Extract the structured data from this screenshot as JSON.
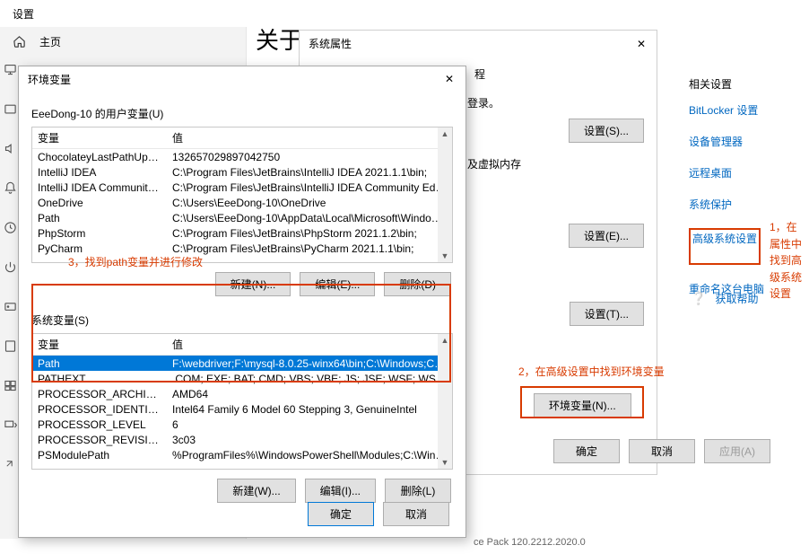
{
  "titlebar": "设置",
  "sidebar": {
    "home": "主页"
  },
  "content": {
    "heading": "关于"
  },
  "related": {
    "title": "相关设置",
    "links": [
      "BitLocker 设置",
      "设备管理器",
      "远程桌面",
      "系统保护",
      "高级系统设置",
      "重命名这台电脑"
    ],
    "help": "获取帮助"
  },
  "ann": {
    "a1": "1，在属性中找到高级系统设置",
    "a2": "2，在高级设置中找到环境变量",
    "a3": "3，找到path变量并进行修改"
  },
  "sysprop": {
    "title": "系统属性",
    "tab_extra": "程",
    "line1": "登录。",
    "line2": "及虚拟内存",
    "btn_s": "设置(S)...",
    "btn_e": "设置(E)...",
    "btn_t": "设置(T)...",
    "env_btn": "环境变量(N)...",
    "ok": "确定",
    "cancel": "取消",
    "apply": "应用(A)",
    "pack": "ce Pack 120.2212.2020.0"
  },
  "envdlg": {
    "title": "环境变量",
    "user_label": "EeeDong-10 的用户变量(U)",
    "sys_label": "系统变量(S)",
    "hdr_var": "变量",
    "hdr_val": "值",
    "btn_new_u": "新建(N)...",
    "btn_edit_u": "编辑(E)...",
    "btn_del_u": "删除(D)",
    "btn_new_s": "新建(W)...",
    "btn_edit_s": "编辑(I)...",
    "btn_del_s": "删除(L)",
    "ok": "确定",
    "cancel": "取消",
    "user_rows": [
      {
        "var": "ChocolateyLastPathUpdate",
        "val": "132657029897042750"
      },
      {
        "var": "IntelliJ IDEA",
        "val": "C:\\Program Files\\JetBrains\\IntelliJ IDEA 2021.1.1\\bin;"
      },
      {
        "var": "IntelliJ IDEA Community E...",
        "val": "C:\\Program Files\\JetBrains\\IntelliJ IDEA Community Edition 20..."
      },
      {
        "var": "OneDrive",
        "val": "C:\\Users\\EeeDong-10\\OneDrive"
      },
      {
        "var": "Path",
        "val": "C:\\Users\\EeeDong-10\\AppData\\Local\\Microsoft\\WindowsAp..."
      },
      {
        "var": "PhpStorm",
        "val": "C:\\Program Files\\JetBrains\\PhpStorm 2021.1.2\\bin;"
      },
      {
        "var": "PyCharm",
        "val": "C:\\Program Files\\JetBrains\\PyCharm 2021.1.1\\bin;"
      }
    ],
    "sys_rows": [
      {
        "var": "Path",
        "val": "F:\\webdriver;F:\\mysql-8.0.25-winx64\\bin;C:\\Windows;C:\\Wind...",
        "sel": true
      },
      {
        "var": "PATHEXT",
        "val": ".COM;.EXE;.BAT;.CMD;.VBS;.VBE;.JS;.JSE;.WSF;.WSH;.MSC"
      },
      {
        "var": "PROCESSOR_ARCHITECT...",
        "val": "AMD64"
      },
      {
        "var": "PROCESSOR_IDENTIFIER",
        "val": "Intel64 Family 6 Model 60 Stepping 3, GenuineIntel"
      },
      {
        "var": "PROCESSOR_LEVEL",
        "val": "6"
      },
      {
        "var": "PROCESSOR_REVISION",
        "val": "3c03"
      },
      {
        "var": "PSModulePath",
        "val": "%ProgramFiles%\\WindowsPowerShell\\Modules;C:\\Windows\\..."
      }
    ]
  }
}
